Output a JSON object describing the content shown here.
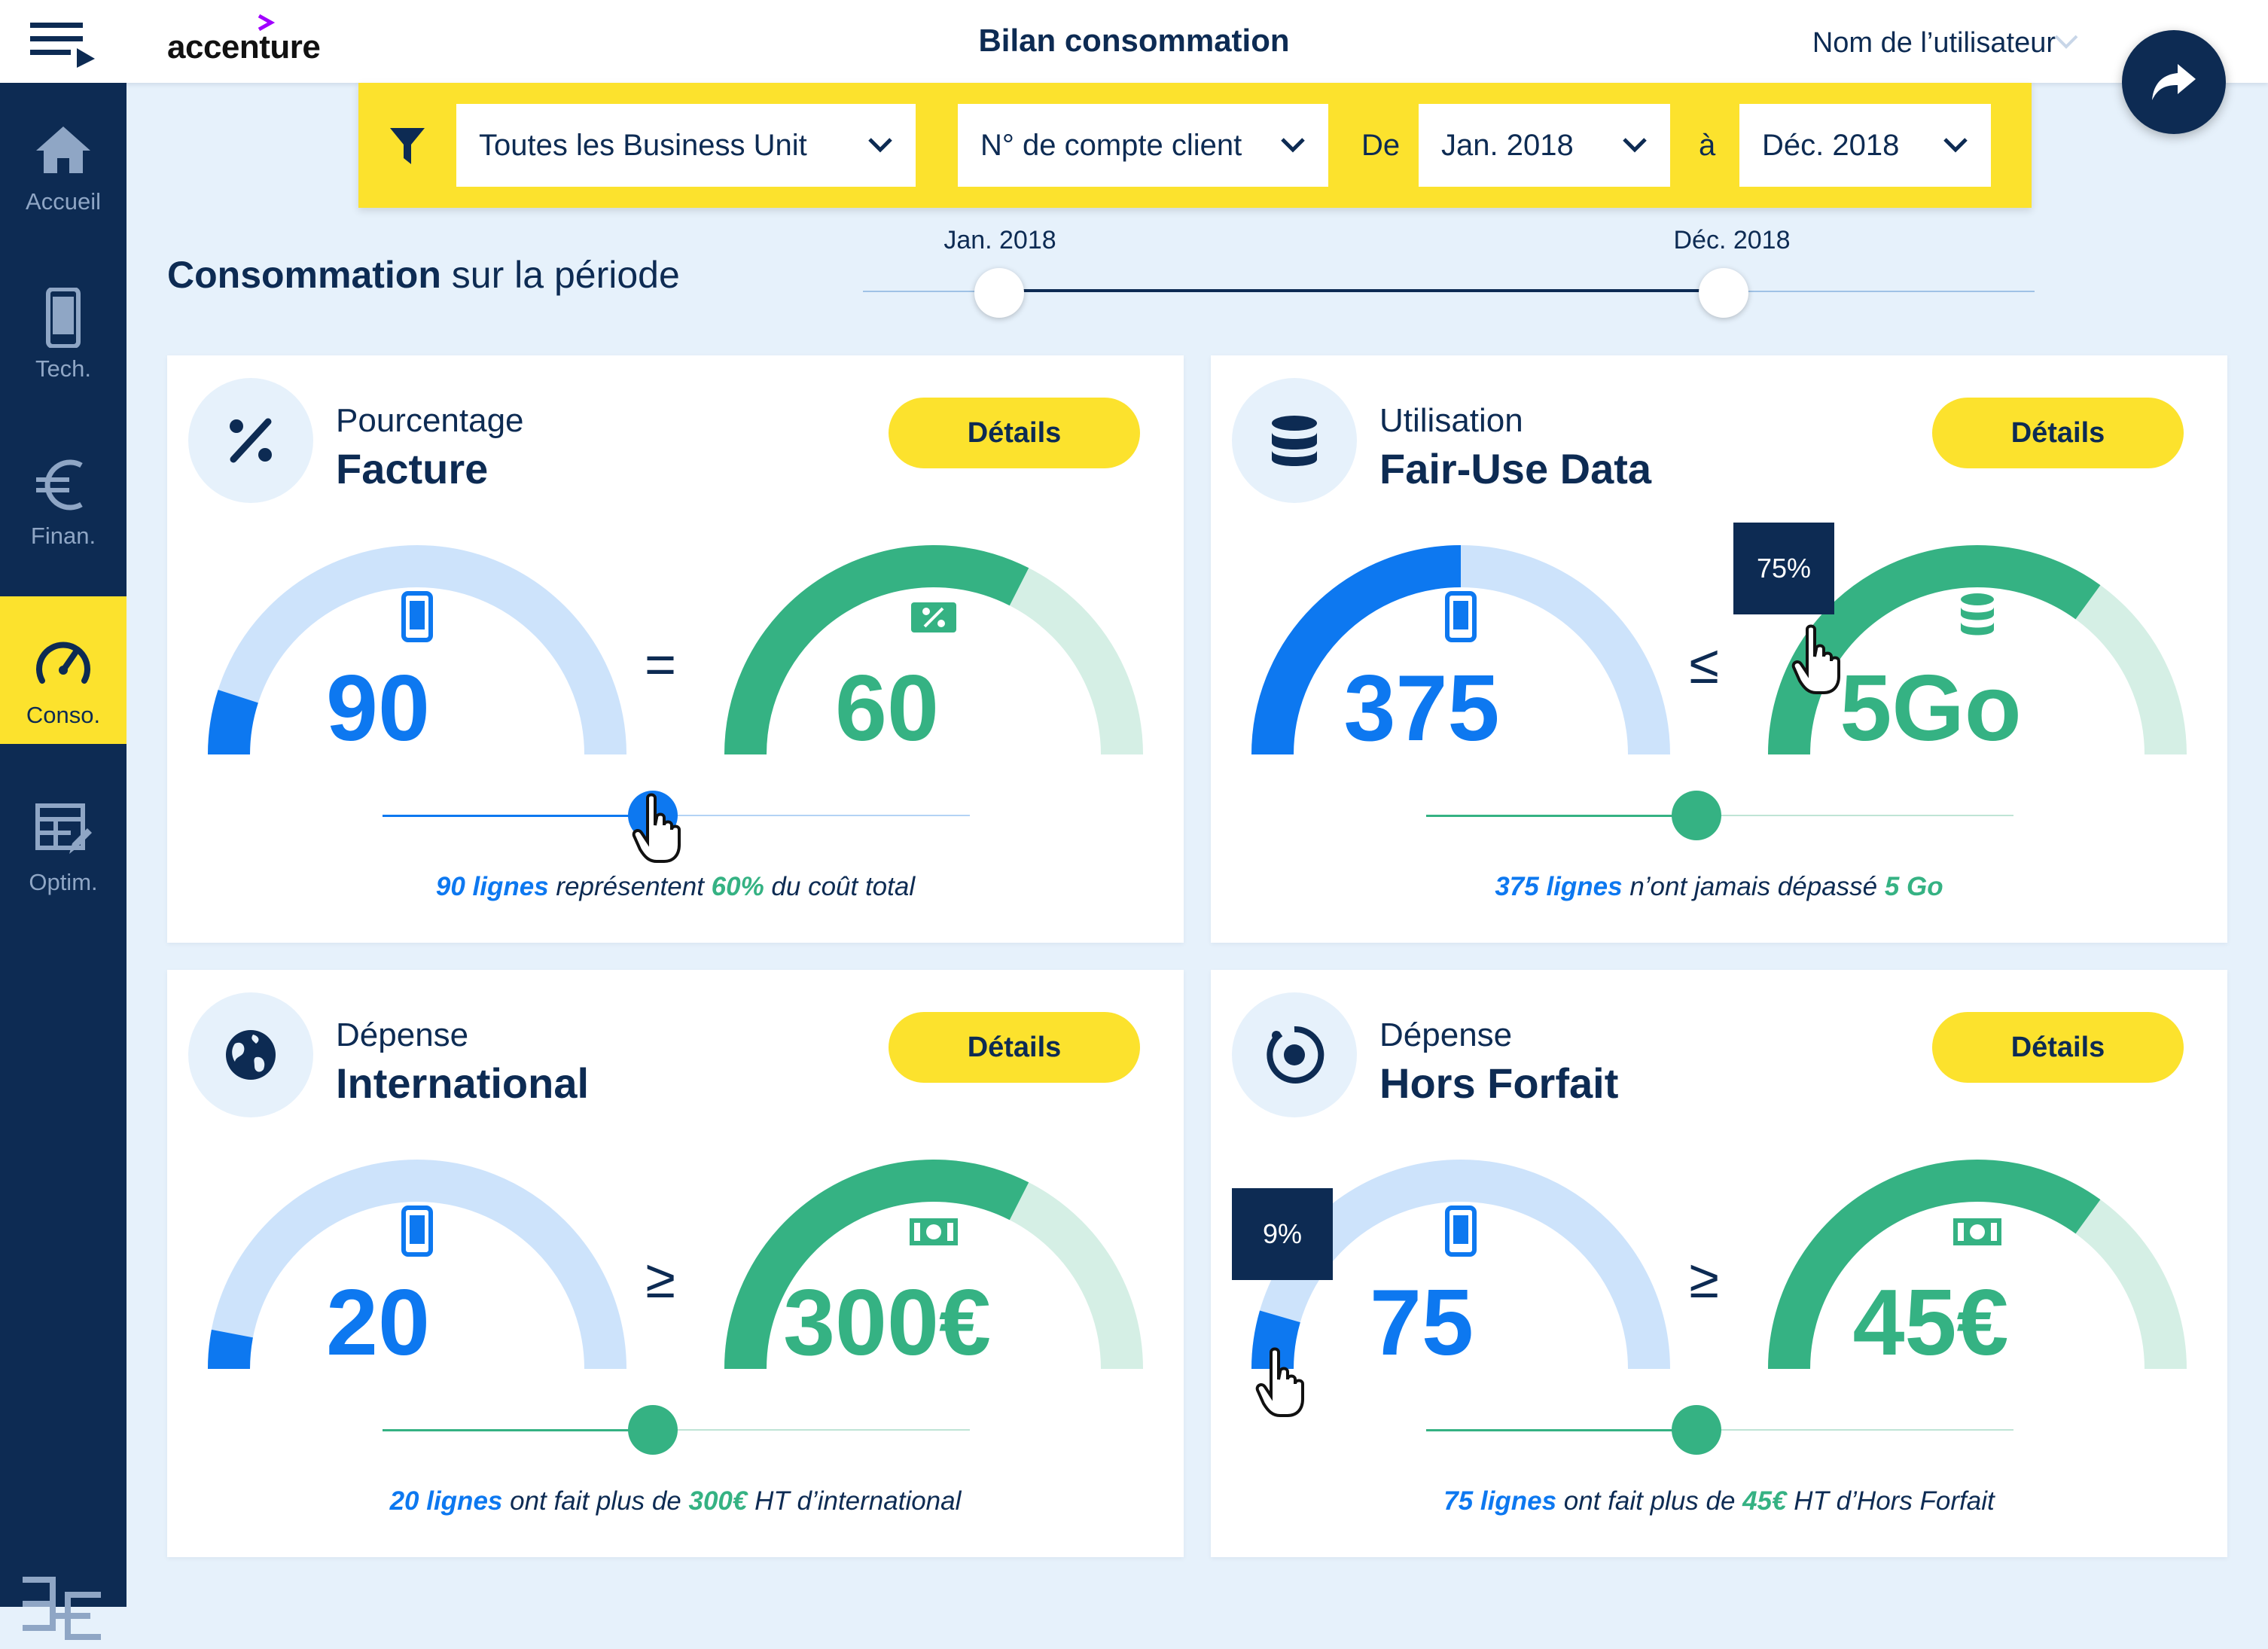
{
  "header": {
    "brand": "accenture",
    "title": "Bilan consommation",
    "user_name": "Nom de l’utilisateur"
  },
  "sidebar": {
    "items": [
      {
        "label": "Accueil",
        "icon": "home-icon"
      },
      {
        "label": "Tech.",
        "icon": "phone-icon"
      },
      {
        "label": "Finan.",
        "icon": "euro-icon"
      },
      {
        "label": "Conso.",
        "icon": "gauge-icon",
        "active": true
      },
      {
        "label": "Optim.",
        "icon": "table-edit-icon"
      }
    ]
  },
  "filters": {
    "business_unit": "Toutes les Business Unit",
    "account": "N° de compte client",
    "from_label": "De",
    "from_value": "Jan. 2018",
    "to_label": "à",
    "to_value": "Déc. 2018"
  },
  "period": {
    "title_bold": "Consommation",
    "title_rest": " sur la période",
    "start_label": "Jan. 2018",
    "end_label": "Déc. 2018"
  },
  "cards": [
    {
      "subtitle": "Pourcentage",
      "title": "Facture",
      "details": "Détails",
      "left_value": "90",
      "operator": "=",
      "right_value": "60",
      "left_fill": 0.1,
      "right_fill": 0.65,
      "slider": 0.46,
      "caption": {
        "v1": "90 lignes",
        "t1": " représentent ",
        "v2": "60%",
        "t2": " du coût total"
      }
    },
    {
      "subtitle": "Utilisation",
      "title": "Fair-Use Data",
      "details": "Détails",
      "left_value": "375",
      "operator": "≤",
      "right_value": "5Go",
      "left_fill": 0.5,
      "right_fill": 0.7,
      "slider": 0.46,
      "tooltip": "75%",
      "caption": {
        "v1": "375 lignes",
        "t1": " n’ont jamais dépassé ",
        "v2": "5 Go",
        "t2": ""
      }
    },
    {
      "subtitle": "Dépense",
      "title": "International",
      "details": "Détails",
      "left_value": "20",
      "operator": "≥",
      "right_value": "300€",
      "left_fill": 0.06,
      "right_fill": 0.65,
      "slider": 0.46,
      "caption": {
        "v1": "20 lignes",
        "t1": " ont fait plus de ",
        "v2": "300€",
        "t2": " HT d’international"
      }
    },
    {
      "subtitle": "Dépense",
      "title": "Hors Forfait",
      "details": "Détails",
      "left_value": "75",
      "operator": "≥",
      "right_value": "45€",
      "left_fill": 0.09,
      "right_fill": 0.7,
      "slider": 0.46,
      "tooltip": "9%",
      "caption": {
        "v1": "75 lignes",
        "t1": " ont fait plus de ",
        "v2": "45€",
        "t2": " HT d’Hors Forfait"
      }
    }
  ],
  "colors": {
    "navy": "#0d2b53",
    "yellow": "#fce22d",
    "blue": "#0d78f0",
    "blue_light": "#cde3fb",
    "green": "#35b283",
    "green_light": "#d5efe5",
    "background": "#e6f1fb"
  }
}
